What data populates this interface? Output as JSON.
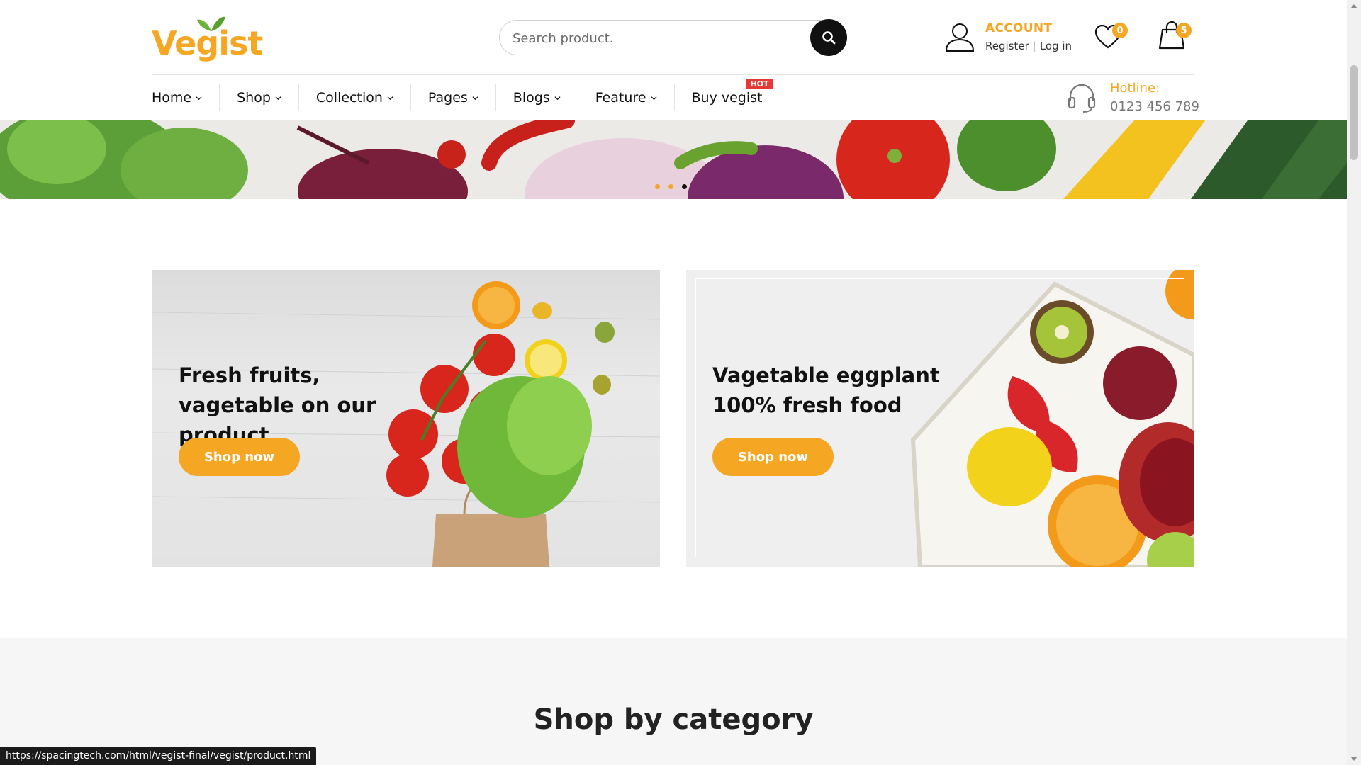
{
  "brand": {
    "logo_text": "Vegist",
    "accent": "#f5a623"
  },
  "search": {
    "placeholder": "Search product."
  },
  "account": {
    "title": "ACCOUNT",
    "register": "Register",
    "login": "Log in"
  },
  "wishlist": {
    "count": "0"
  },
  "cart": {
    "count": "5"
  },
  "nav": {
    "items": [
      {
        "label": "Home"
      },
      {
        "label": "Shop"
      },
      {
        "label": "Collection"
      },
      {
        "label": "Pages"
      },
      {
        "label": "Blogs"
      },
      {
        "label": "Feature"
      },
      {
        "label": "Buy vegist",
        "badge": "HOT"
      }
    ]
  },
  "hotline": {
    "title": "Hotline:",
    "number": "0123 456 789"
  },
  "banners": [
    {
      "title": "Fresh fruits, vagetable on our product",
      "button": "Shop now"
    },
    {
      "title": "Vagetable eggplant 100% fresh food",
      "button": "Shop now"
    }
  ],
  "category": {
    "title": "Shop by category"
  },
  "status_bar": {
    "url": "https://spacingtech.com/html/vegist-final/vegist/product.html"
  }
}
